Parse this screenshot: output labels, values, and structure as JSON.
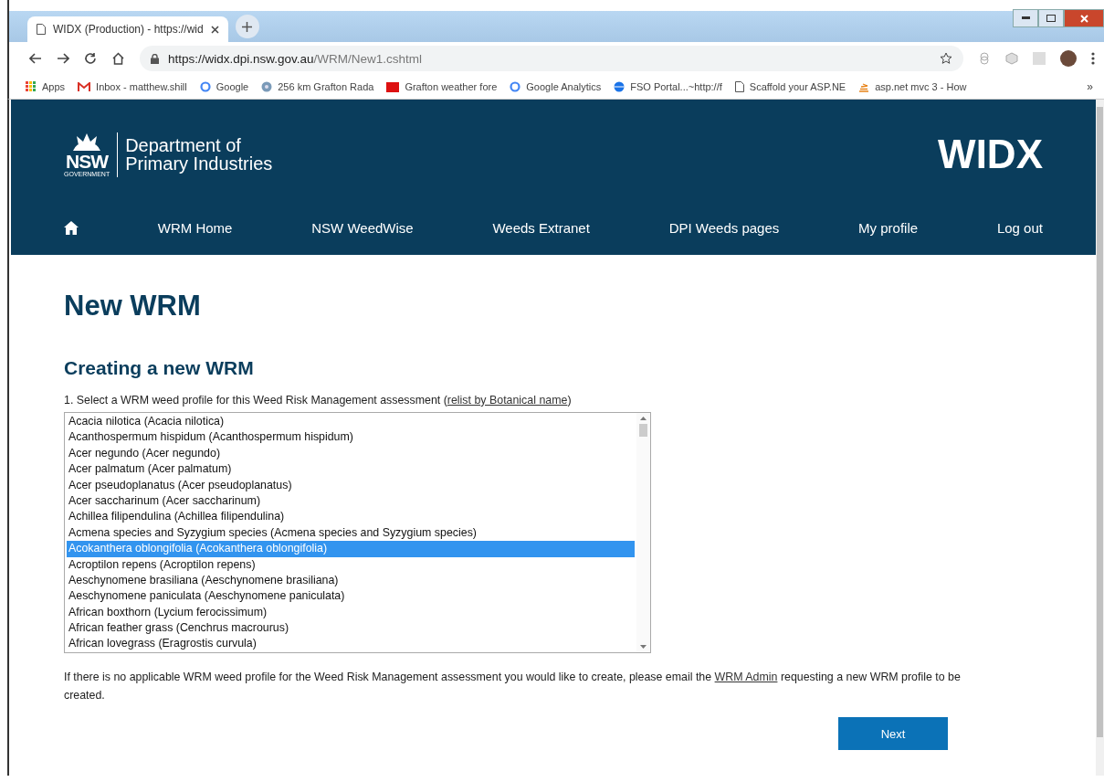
{
  "browser": {
    "tab": {
      "title": "WIDX (Production) - https://wid",
      "selected": true
    },
    "url": {
      "host": "https://widx.dpi.nsw.gov.au",
      "path": "/WRM/New1.cshtml"
    },
    "bookmarks": [
      {
        "label": "Apps",
        "kind": "apps"
      },
      {
        "label": "Inbox - matthew.shill",
        "kind": "mail"
      },
      {
        "label": "Google",
        "kind": "google"
      },
      {
        "label": "256 km Grafton Rada",
        "kind": "radar"
      },
      {
        "label": "Grafton weather fore",
        "kind": "weather"
      },
      {
        "label": "Google Analytics",
        "kind": "google"
      },
      {
        "label": "FSO Portal...~http://f",
        "kind": "globe"
      },
      {
        "label": "Scaffold your ASP.NE",
        "kind": "page"
      },
      {
        "label": "asp.net mvc 3 - How",
        "kind": "stack"
      }
    ],
    "more": "»"
  },
  "header": {
    "org_line1": "Department of",
    "org_line2": "Primary Industries",
    "logo_text": "NSW",
    "logo_sub": "GOVERNMENT",
    "app_name": "WIDX",
    "nav": [
      "WRM Home",
      "NSW WeedWise",
      "Weeds Extranet",
      "DPI Weeds pages",
      "My profile",
      "Log out"
    ]
  },
  "page": {
    "title": "New WRM",
    "subtitle": "Creating a new WRM",
    "instruction": {
      "before": "1. Select a WRM weed profile for this Weed Risk Management assessment (",
      "link": "relist by Botanical name",
      "after": ")"
    },
    "profiles": [
      {
        "label": "Acacia nilotica (Acacia nilotica)",
        "selected": false
      },
      {
        "label": "Acanthospermum hispidum (Acanthospermum hispidum)",
        "selected": false
      },
      {
        "label": "Acer negundo (Acer negundo)",
        "selected": false
      },
      {
        "label": "Acer palmatum (Acer palmatum)",
        "selected": false
      },
      {
        "label": "Acer pseudoplanatus (Acer pseudoplanatus)",
        "selected": false
      },
      {
        "label": "Acer saccharinum (Acer saccharinum)",
        "selected": false
      },
      {
        "label": "Achillea filipendulina (Achillea filipendulina)",
        "selected": false
      },
      {
        "label": "Acmena species and Syzygium species (Acmena species and Syzygium species)",
        "selected": false
      },
      {
        "label": "Acokanthera oblongifolia (Acokanthera oblongifolia)",
        "selected": true
      },
      {
        "label": "Acroptilon repens (Acroptilon repens)",
        "selected": false
      },
      {
        "label": "Aeschynomene brasiliana (Aeschynomene brasiliana)",
        "selected": false
      },
      {
        "label": "Aeschynomene paniculata (Aeschynomene paniculata)",
        "selected": false
      },
      {
        "label": "African boxthorn (Lycium ferocissimum)",
        "selected": false
      },
      {
        "label": "African feather grass (Cenchrus macrourus)",
        "selected": false
      },
      {
        "label": "African lovegrass (Eragrostis curvula)",
        "selected": false
      }
    ],
    "notice": {
      "before": "If there is no applicable WRM weed profile for the Weed Risk Management assessment you would like to create, please email the ",
      "link": "WRM Admin",
      "after": " requesting a new WRM profile to be created."
    },
    "next_button": "Next"
  }
}
